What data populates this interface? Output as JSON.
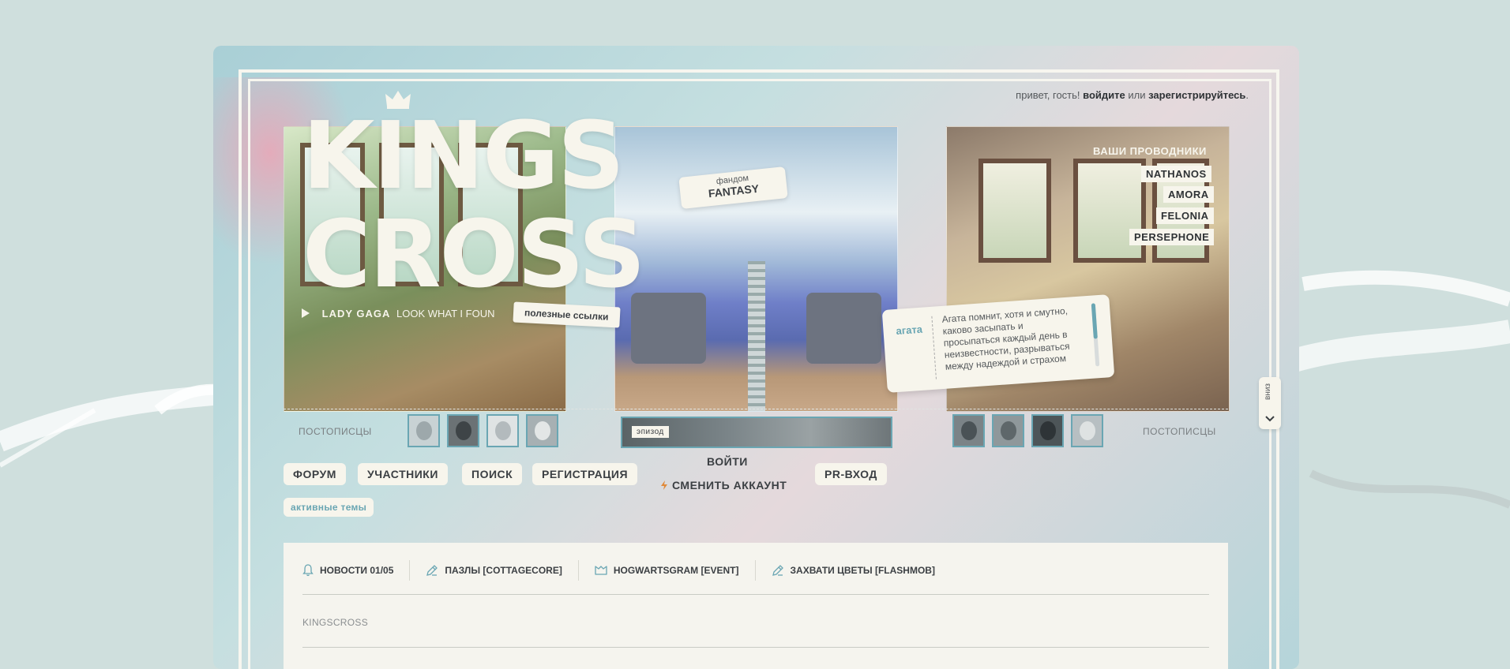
{
  "header": {
    "greeting_prefix": "привет, гость!",
    "login_link": "войдите",
    "or": "или",
    "register_link": "зарегистрируйтесь",
    "greeting_suffix": "."
  },
  "logo": {
    "line1": "KINGS",
    "line2": "CROSS"
  },
  "music": {
    "artist": "LADY GAGA",
    "track": "LOOK WHAT I FOUN"
  },
  "useful_links": "полезные ссылки",
  "fandom": {
    "label": "фандом",
    "value": "FANTASY"
  },
  "guides": {
    "title": "ВАШИ ПРОВОДНИКИ",
    "names": [
      "NATHANOS",
      "AMORA",
      "FELONIA",
      "PERSEPHONE"
    ]
  },
  "quote": {
    "author": "агата",
    "text": "Агата помнит, хотя и смутно, каково засыпать и просыпаться каждый день в неизвестности, разрываться между надеждой и страхом"
  },
  "scroll_down": "вниз",
  "posters": {
    "left_label": "ПОСТОПИСЦЫ",
    "right_label": "ПОСТОПИСЦЫ"
  },
  "episode_label": "эпизод",
  "nav": {
    "forum": "ФОРУМ",
    "members": "УЧАСТНИКИ",
    "search": "ПОИСК",
    "register": "РЕГИСТРАЦИЯ",
    "login": "ВОЙТИ",
    "switch_account": "СМЕНИТЬ АККАУНТ",
    "pr_login": "PR-ВХОД"
  },
  "active_topics": "активные темы",
  "news": [
    {
      "icon": "bell-icon",
      "label": "НОВОСТИ 01/05"
    },
    {
      "icon": "pencil-icon",
      "label": "ПАЗЛЫ [COTTAGECORE]"
    },
    {
      "icon": "envelope-icon",
      "label": "HOGWARTSGRAM [EVENT]"
    },
    {
      "icon": "pencil-icon",
      "label": "ЗАХВАТИ ЦВЕТЫ [FLASHMOB]"
    }
  ],
  "section_title": "KINGSCROSS",
  "colors": {
    "accent": "#6aa6b3",
    "paper": "#f7f5ec",
    "text": "#3b3f43"
  }
}
